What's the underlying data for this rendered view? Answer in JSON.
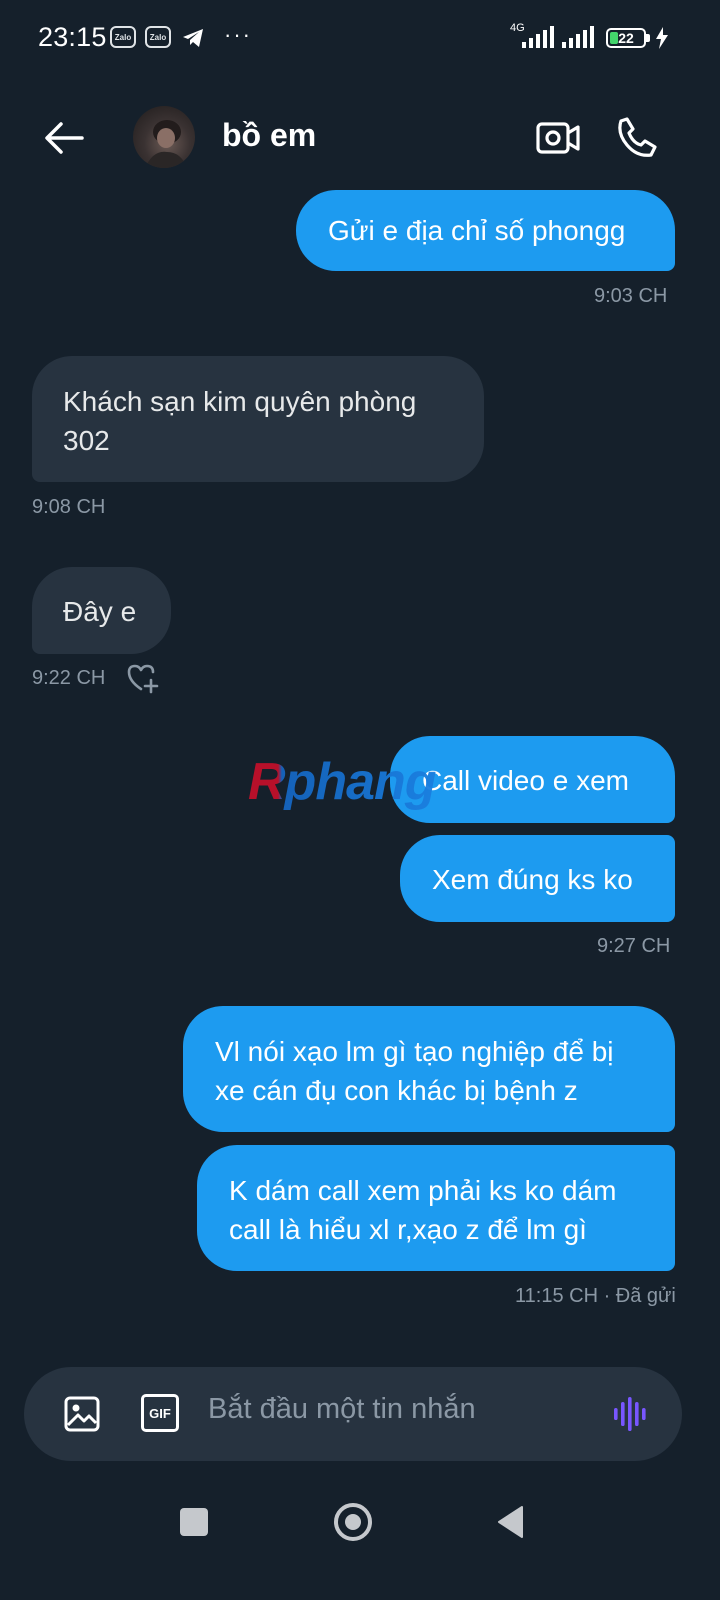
{
  "status_bar": {
    "time": "23:15",
    "notification_icons": [
      "zalo-icon",
      "zalo-icon",
      "telegram-icon"
    ],
    "zalo_label": "Zalo",
    "more": "···",
    "network": "4G",
    "battery": "22"
  },
  "header": {
    "contact_name": "bồ em",
    "icons": [
      "back-arrow-icon",
      "video-call-icon",
      "phone-call-icon"
    ]
  },
  "messages": [
    {
      "direction": "out",
      "text": "Gửi e địa chỉ số phongg"
    },
    {
      "meta": "9:03 CH"
    },
    {
      "direction": "in",
      "text_lines": [
        "Khách sạn kim quyên  phòng",
        "302"
      ]
    },
    {
      "meta": "9:08 CH"
    },
    {
      "direction": "in",
      "text": "Đây e"
    },
    {
      "meta": "9:22 CH",
      "reaction_icon": "heart-add-icon"
    },
    {
      "direction": "out",
      "text": "Call video e xem"
    },
    {
      "direction": "out",
      "text": "Xem đúng ks ko"
    },
    {
      "meta": "9:27 CH"
    },
    {
      "direction": "out",
      "text_lines": [
        "Vl nói xạo lm gì tạo nghiệp để bị",
        "xe cán đụ con khác bị bệnh z"
      ]
    },
    {
      "direction": "out",
      "text_lines": [
        "K dám call xem phải ks ko dám",
        "call là hiểu xl r,xạo z để lm gì"
      ]
    },
    {
      "meta": "11:15 CH · Đã gửi"
    }
  ],
  "watermark": "Rphang",
  "composer": {
    "placeholder": "Bắt đầu một tin nhắn",
    "gif_label": "GIF",
    "icons": [
      "image-icon",
      "gif-icon",
      "voice-icon"
    ]
  },
  "colors": {
    "background": "#15202b",
    "outgoing_bubble": "#1d9bf0",
    "incoming_bubble": "#273340",
    "meta_text": "#8b98a5",
    "voice_accent": "#7856ff"
  }
}
